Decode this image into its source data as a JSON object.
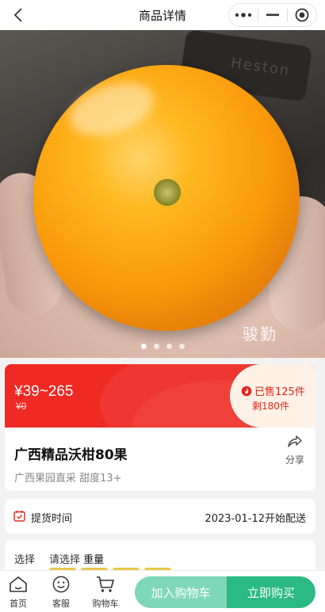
{
  "header": {
    "title": "商品详情",
    "back_icon": "chevron-left-icon",
    "more_icon": "more-dots-icon",
    "minimize_icon": "minimize-icon",
    "close_icon": "target-circle-icon"
  },
  "gallery": {
    "watermark": "骏勤",
    "slide_count": 4,
    "active_index": 0,
    "plate_text": "Heston"
  },
  "price": {
    "range": "¥39~265",
    "original": "¥0",
    "sold": "已售125件",
    "stock": "剩180件",
    "accent": "#ef2a24",
    "flame_icon": "flame-icon"
  },
  "product": {
    "name": "广西精品沃柑80果",
    "subtitle": "广西果园直采 甜度13+",
    "share_label": "分享",
    "share_icon": "share-icon"
  },
  "pickup": {
    "label": "提货时间",
    "value": "2023-01-12开始配送",
    "icon": "calendar-check-icon"
  },
  "select": {
    "label": "选择",
    "prompt": "请选择",
    "option": "重量"
  },
  "bottom_bar": {
    "tabs": [
      {
        "label": "首页",
        "icon": "home-icon"
      },
      {
        "label": "客服",
        "icon": "smile-icon"
      },
      {
        "label": "购物车",
        "icon": "cart-icon"
      }
    ],
    "add_to_cart": "加入购物车",
    "buy_now": "立即购买",
    "cart_color": "#7fd7b9",
    "buy_color": "#2bb984"
  }
}
